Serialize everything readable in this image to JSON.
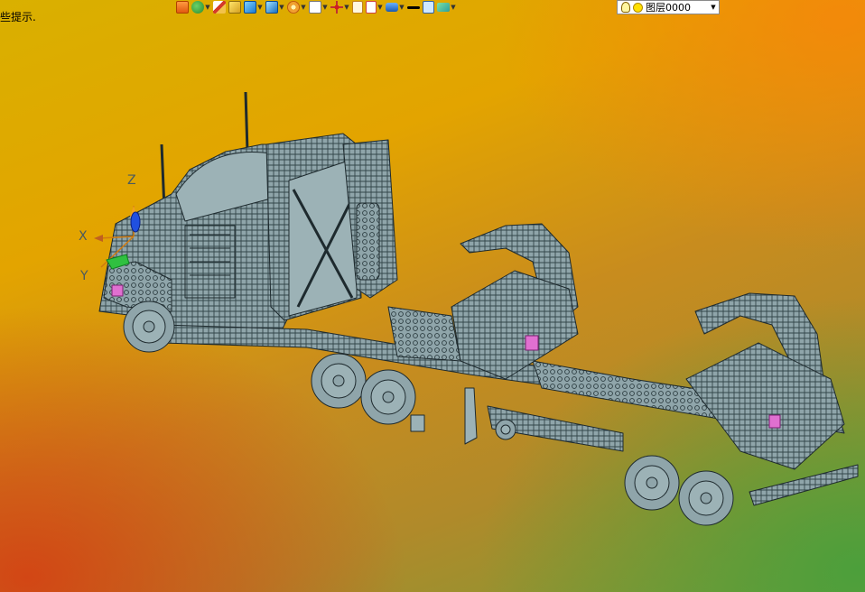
{
  "hint_text": "些提示.",
  "toolbar": {
    "icons": [
      "import-icon",
      "tools-icon",
      "pencil-icon",
      "box-yellow-icon",
      "box-blue-icon",
      "cube-icon",
      "pie-icon",
      "view-icon",
      "crosshair-icon",
      "page-icon",
      "page-red-icon",
      "render-icon",
      "line-color-icon",
      "fill-color-icon",
      "material-icon"
    ]
  },
  "layer": {
    "value": "图层0000"
  },
  "axis": {
    "x": "X",
    "y": "Y",
    "z": "Z"
  },
  "colors": {
    "model_fill": "#8fa5aa",
    "model_line": "#1e2a2e",
    "z_axis": "#2050e0",
    "x_axis": "#cf7a10",
    "y_axis": "#30c040",
    "accent_pink": "#e070d0"
  }
}
